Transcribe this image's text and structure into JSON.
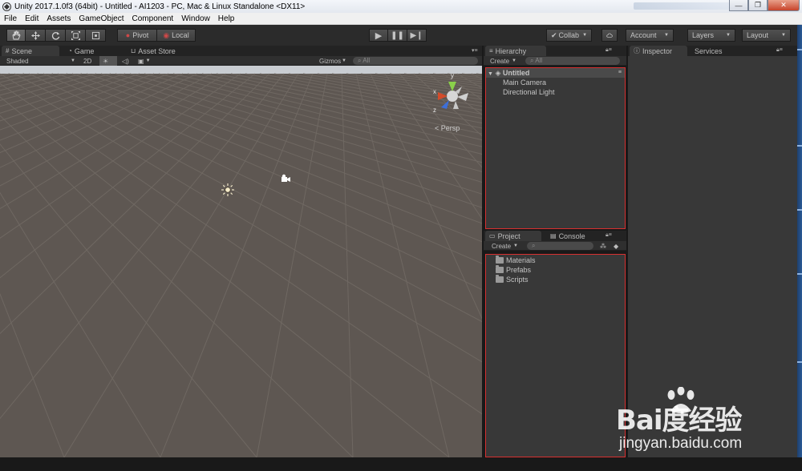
{
  "window": {
    "title": "Unity 2017.1.0f3 (64bit) - Untitled - AI1203 - PC, Mac & Linux Standalone <DX11>",
    "minimize": "—",
    "maximize": "❐",
    "close": "✕"
  },
  "menu": [
    "File",
    "Edit",
    "Assets",
    "GameObject",
    "Component",
    "Window",
    "Help"
  ],
  "toolbar": {
    "pivot": "Pivot",
    "local": "Local",
    "collab": "Collab",
    "account": "Account",
    "layers": "Layers",
    "layout": "Layout"
  },
  "scene": {
    "tabs": [
      "Scene",
      "Game",
      "Asset Store"
    ],
    "shading": "Shaded",
    "mode_2d": "2D",
    "gizmos": "Gizmos",
    "search_placeholder": "All",
    "persp": "Persp",
    "axis_labels": {
      "x": "x",
      "y": "y",
      "z": "z"
    }
  },
  "hierarchy": {
    "tab": "Hierarchy",
    "create": "Create",
    "search_placeholder": "All",
    "scene_name": "Untitled",
    "items": [
      "Main Camera",
      "Directional Light"
    ]
  },
  "inspector": {
    "tabs": [
      "Inspector",
      "Services"
    ]
  },
  "project": {
    "tabs": [
      "Project",
      "Console"
    ],
    "create": "Create",
    "folders": [
      "Materials",
      "Prefabs",
      "Scripts"
    ]
  },
  "watermark": {
    "logo": "Bai度经验",
    "url": "jingyan.baidu.com"
  },
  "colors": {
    "highlight_border": "#d73030",
    "scene_ground": "#5e5752",
    "scene_sky": "#c9cdd2"
  }
}
